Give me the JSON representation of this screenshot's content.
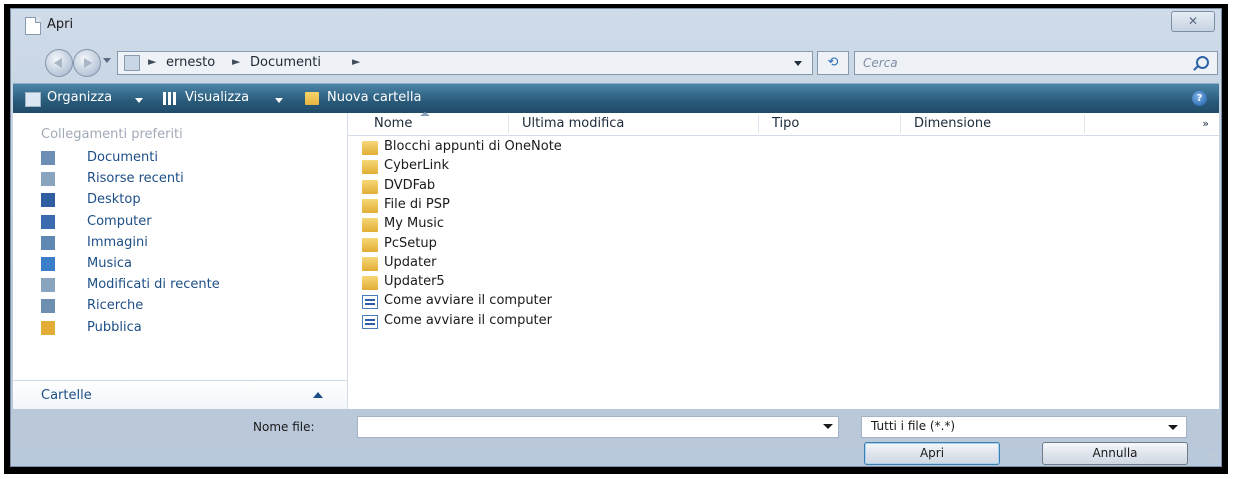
{
  "window": {
    "title": "Apri",
    "close_label": "✕"
  },
  "address_bar": {
    "breadcrumbs": [
      "ernesto",
      "Documenti"
    ],
    "separator": "►",
    "refresh_label": "⟲",
    "search_placeholder": "Cerca"
  },
  "toolbar": {
    "organizza": "Organizza",
    "visualizza": "Visualizza",
    "nuova_cartella": "Nuova cartella",
    "help": "?"
  },
  "sidebar": {
    "heading": "Collegamenti preferiti",
    "items": [
      {
        "label": "Documenti",
        "icon": "documents-icon",
        "color": "#6e8fb5"
      },
      {
        "label": "Risorse recenti",
        "icon": "recent-items-icon",
        "color": "#8aa3bf"
      },
      {
        "label": "Desktop",
        "icon": "desktop-icon",
        "color": "#2f5fa0"
      },
      {
        "label": "Computer",
        "icon": "computer-icon",
        "color": "#3a6ab0"
      },
      {
        "label": "Immagini",
        "icon": "pictures-icon",
        "color": "#5f88b4"
      },
      {
        "label": "Musica",
        "icon": "music-icon",
        "color": "#3c7dc8"
      },
      {
        "label": "Modificati di recente",
        "icon": "recently-changed-icon",
        "color": "#8aa3bf"
      },
      {
        "label": "Ricerche",
        "icon": "searches-icon",
        "color": "#6f8fb0"
      },
      {
        "label": "Pubblica",
        "icon": "public-folder-icon",
        "color": "#e2ad35"
      }
    ],
    "folders_label": "Cartelle"
  },
  "file_list": {
    "columns": [
      "Nome",
      "Ultima modifica",
      "Tipo",
      "Dimensione"
    ],
    "more_columns": "»",
    "items": [
      {
        "name": "Blocchi appunti di OneNote",
        "type": "folder"
      },
      {
        "name": "CyberLink",
        "type": "folder"
      },
      {
        "name": "DVDFab",
        "type": "folder"
      },
      {
        "name": "File di PSP",
        "type": "folder"
      },
      {
        "name": "My Music",
        "type": "folder"
      },
      {
        "name": "PcSetup",
        "type": "folder"
      },
      {
        "name": "Updater",
        "type": "folder"
      },
      {
        "name": "Updater5",
        "type": "folder"
      },
      {
        "name": "Come avviare il computer",
        "type": "document"
      },
      {
        "name": "Come avviare il computer",
        "type": "document"
      }
    ]
  },
  "footer": {
    "filename_label": "Nome file:",
    "filename_value": "",
    "filter_value": "Tutti i file (*.*)",
    "open_button": "Apri",
    "cancel_button": "Annulla"
  }
}
